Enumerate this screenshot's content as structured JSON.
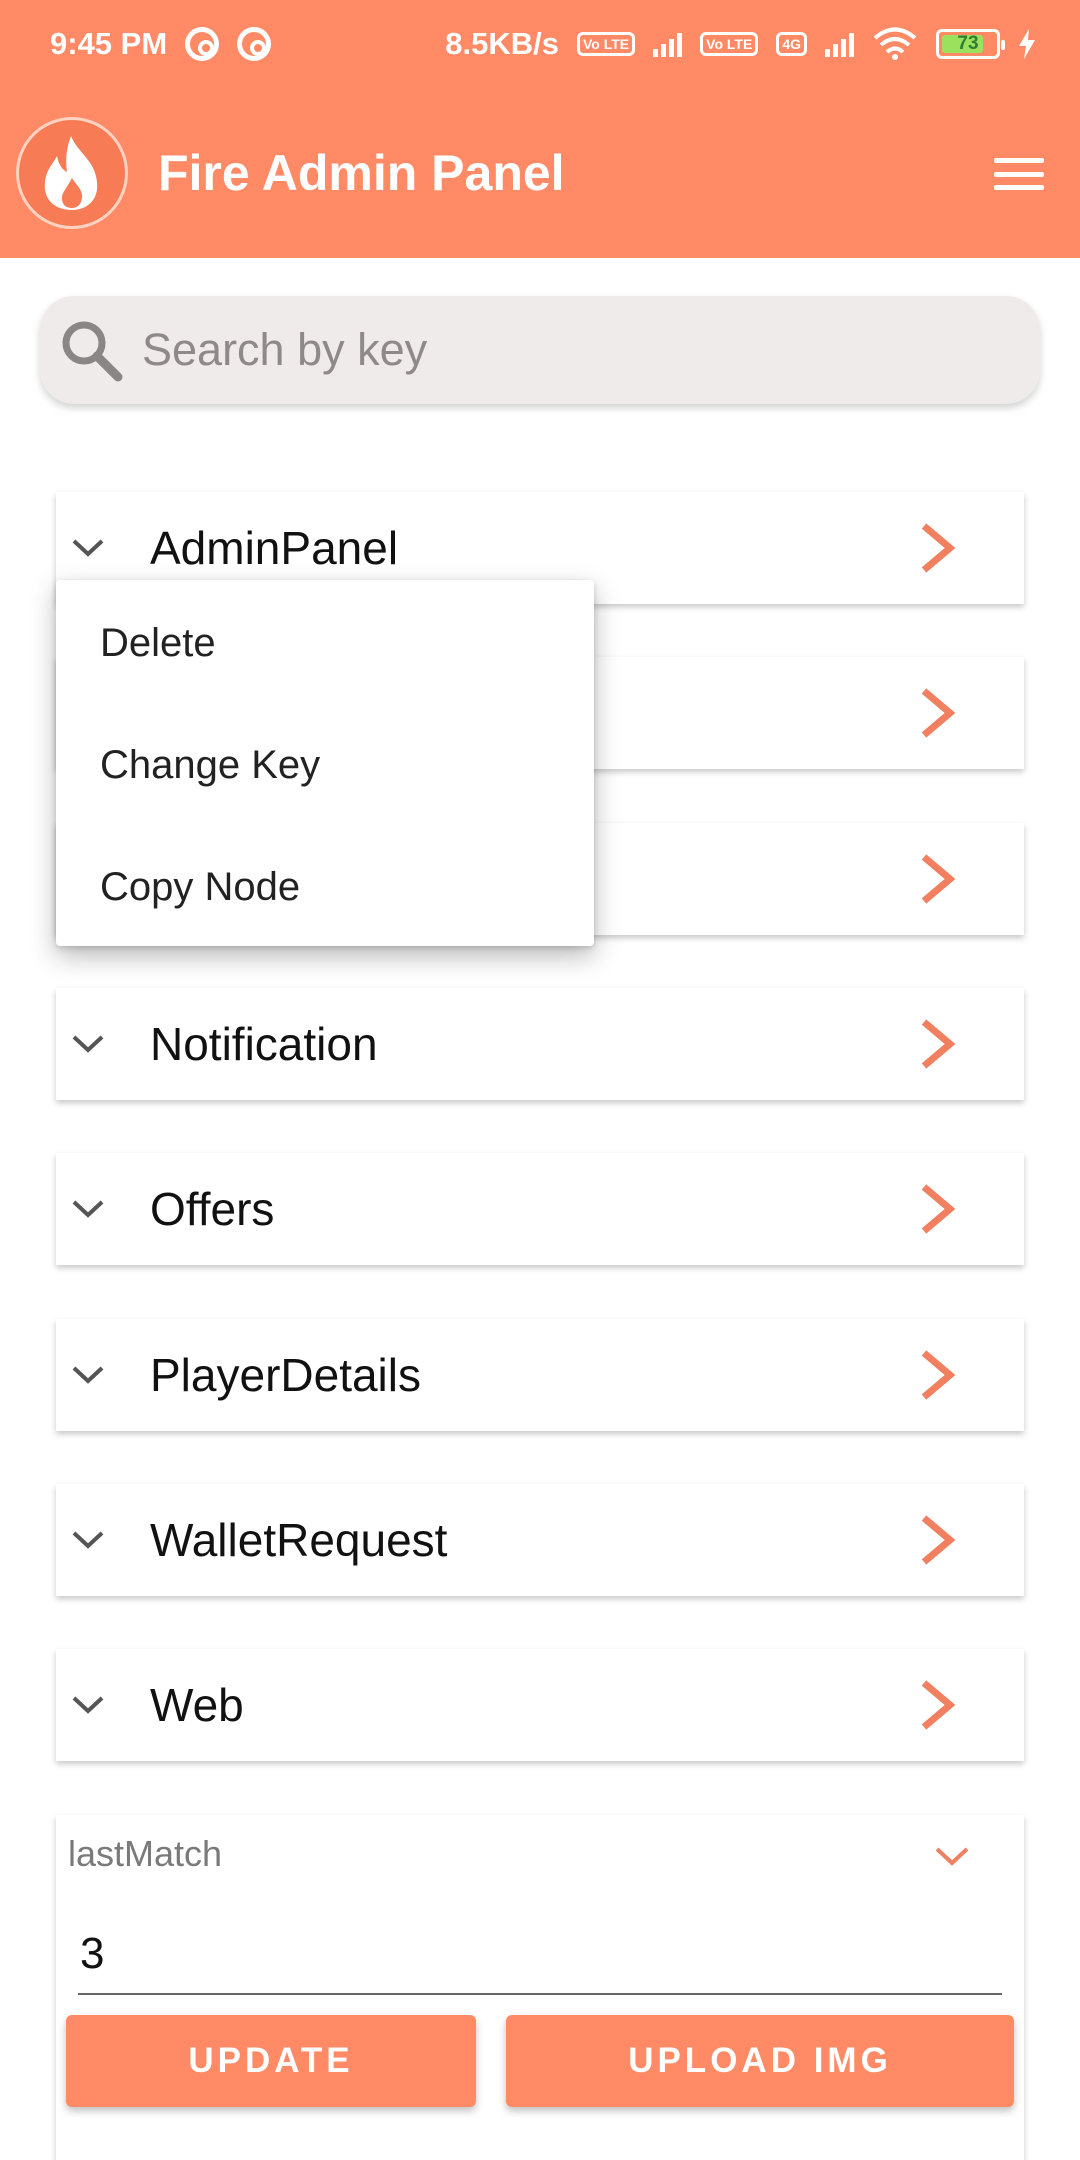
{
  "status_bar": {
    "time": "9:45 PM",
    "net_speed": "8.5KB/s",
    "volte_tag": "Vo LTE",
    "network_tag": "4G",
    "battery": "73"
  },
  "app_bar": {
    "title": "Fire Admin Panel",
    "logo_icon": "flame-icon",
    "menu_icon": "hamburger-menu-icon"
  },
  "search": {
    "placeholder": "Search by key",
    "value": ""
  },
  "nodes": [
    {
      "label": "AdminPanel"
    },
    {
      "label": ""
    },
    {
      "label": ""
    },
    {
      "label": "Notification"
    },
    {
      "label": "Offers"
    },
    {
      "label": "PlayerDetails"
    },
    {
      "label": "WalletRequest"
    },
    {
      "label": "Web"
    }
  ],
  "context_menu": {
    "items": [
      "Delete",
      "Change Key",
      "Copy Node"
    ]
  },
  "field_card": {
    "key": "lastMatch",
    "value": "3",
    "update_label": "UPDATE",
    "upload_label": "UPLOAD IMG"
  },
  "colors": {
    "primary": "#ff8a65",
    "accent": "#f08060",
    "search_bg": "#efebea"
  }
}
